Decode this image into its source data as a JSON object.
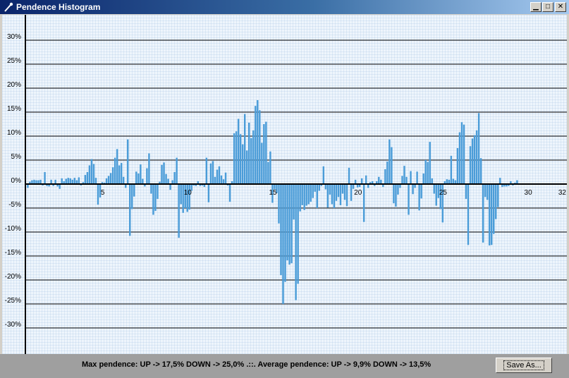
{
  "window": {
    "title": "Pendence Histogram",
    "minimize_icon": "minimize-icon",
    "maximize_icon": "maximize-icon",
    "close_icon": "close-icon"
  },
  "footer": {
    "stats_text": "Max pendence: UP -> 17,5% DOWN -> 25,0% .::. Average pendence: UP -> 9,9% DOWN -> 13,5%",
    "save_button_label": "Save As..."
  },
  "colors": {
    "bar": "#4a9cd8",
    "axis": "#000000",
    "gridline": "#000000"
  },
  "chart_data": {
    "type": "bar",
    "title": "",
    "xlabel": "",
    "ylabel": "",
    "ylim": [
      -35,
      32
    ],
    "xlim": [
      0.5,
      32.2
    ],
    "y_ticks": [
      30,
      25,
      20,
      15,
      10,
      5,
      0,
      -5,
      -10,
      -15,
      -20,
      -25,
      -30
    ],
    "y_tick_labels": [
      "30%",
      "25%",
      "20%",
      "15%",
      "10%",
      "5%",
      "0%",
      "-5%",
      "-10%",
      "-15%",
      "-20%",
      "-25%",
      "-30%"
    ],
    "x_ticks": [
      5,
      10,
      15,
      20,
      25,
      30,
      32
    ],
    "x_tick_labels": [
      "5",
      "10",
      "15",
      "20",
      "25",
      "30",
      "32"
    ],
    "grid": true,
    "bar_step": 0.125,
    "series": [
      {
        "x_start": 0.55,
        "values": [
          -0.8,
          0.5,
          0.8,
          0.9,
          0.8,
          0.8,
          0.9,
          -0.3,
          2.5,
          -0.4,
          -0.5,
          0.9,
          -0.4,
          0.9,
          -0.5,
          -1.0,
          1.2,
          0.6,
          1.1,
          1.3,
          1.2,
          0.9,
          1.3,
          0.8,
          1.4,
          -0.3,
          0.4,
          1.9,
          2.5,
          3.9,
          5.2,
          4.2,
          1.3,
          -4.3,
          -2.8,
          0.4,
          0.3,
          1.2,
          1.7,
          2.3,
          3.5,
          5.5,
          7.3,
          3.9,
          4.4,
          1.5,
          -0.8,
          9.3,
          -10.8,
          -5.2,
          -2.6,
          2.6,
          2.2,
          4.1,
          1.1,
          -0.5,
          3.3,
          6.4,
          -2.0,
          -6.4,
          -5.6,
          -3.1,
          0.5,
          4.0,
          4.5,
          2.1,
          1.1,
          -1.2,
          0.8,
          2.5,
          5.5,
          -11.2,
          -4.2,
          -6.0,
          -5.0,
          -5.8,
          -5.3,
          -1.4,
          -0.3,
          -0.4,
          0.6,
          -0.4,
          -0.3,
          -0.6,
          5.5,
          -3.8,
          4.3,
          4.8,
          1.5,
          3.0,
          3.7,
          1.8,
          1.0,
          2.4,
          -0.3,
          -3.7,
          0.6,
          10.6,
          11.0,
          13.6,
          10.4,
          8.3,
          14.6,
          7.0,
          12.8,
          9.6,
          11.2,
          16.3,
          17.5,
          15.4,
          8.6,
          12.5,
          13.0,
          4.6,
          6.8,
          -3.9,
          -1.1,
          -1.9,
          -8.2,
          -19.0,
          -25.0,
          -20.4,
          -15.9,
          -16.8,
          -16.5,
          -7.4,
          -24.2,
          -20.8,
          -5.7,
          -4.4,
          -5.4,
          -4.5,
          -4.2,
          -3.7,
          -2.9,
          -1.6,
          -5.0,
          -1.4,
          -0.4,
          3.7,
          -1.1,
          -4.9,
          -2.2,
          -4.2,
          -5.0,
          -3.5,
          -2.7,
          -4.4,
          -2.0,
          -3.3,
          -4.6,
          3.4,
          -3.5,
          -1.0,
          0.9,
          -0.7,
          -0.6,
          1.2,
          -7.9,
          1.8,
          -0.8,
          0.4,
          0.6,
          -0.4,
          0.6,
          1.5,
          0.9,
          -0.6,
          3.1,
          4.7,
          9.3,
          7.7,
          -4.0,
          -4.7,
          -2.2,
          -0.8,
          1.7,
          3.8,
          1.5,
          -6.4,
          2.7,
          -2.1,
          -0.8,
          2.6,
          -5.5,
          -3.0,
          2.2,
          5.0,
          4.6,
          8.8,
          1.2,
          -2.0,
          -4.5,
          -2.9,
          -5.2,
          -8.0,
          0.6,
          1.0,
          0.9,
          5.9,
          1.1,
          0.8,
          7.5,
          10.8,
          12.9,
          12.4,
          -3.1,
          -12.7,
          7.9,
          9.5,
          10.2,
          11.2,
          14.8,
          5.4,
          -12.2,
          -2.7,
          -3.3,
          -12.8,
          -12.7,
          -10.4,
          -7.3,
          -4.8,
          1.3,
          -0.6,
          -0.5,
          -0.5,
          -0.4,
          0.6,
          -0.3,
          0.3,
          0.8
        ]
      }
    ]
  }
}
